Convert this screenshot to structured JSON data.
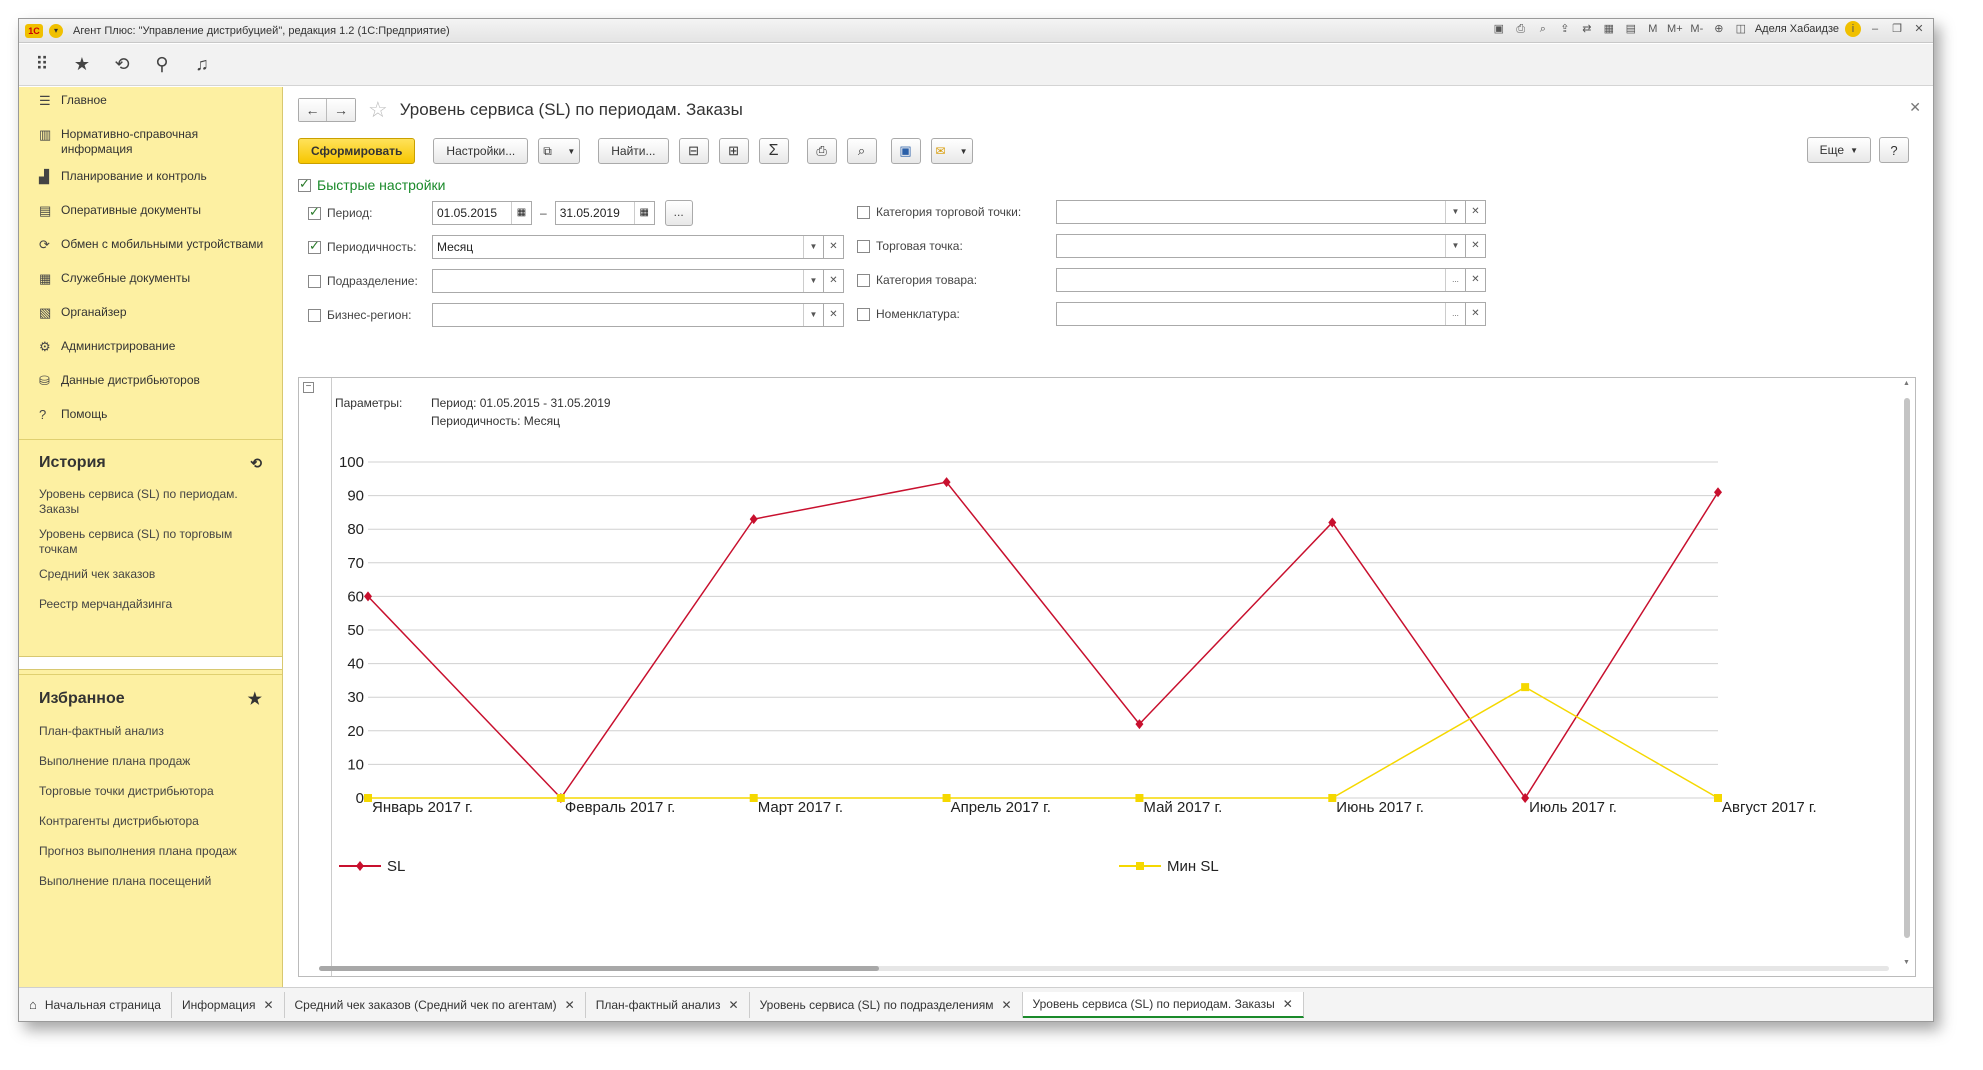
{
  "window": {
    "title": "Агент Плюс: \"Управление дистрибуцией\", редакция 1.2  (1С:Предприятие)",
    "user": "Аделя Хабаидзе"
  },
  "sidebar": {
    "items": [
      {
        "icon": "menu-icon",
        "glyph": "☰",
        "label": "Главное"
      },
      {
        "icon": "catalog-icon",
        "glyph": "▥",
        "label": "Нормативно-справочная информация"
      },
      {
        "icon": "chart-icon",
        "glyph": "▟",
        "label": "Планирование и контроль"
      },
      {
        "icon": "documents-icon",
        "glyph": "▤",
        "label": "Оперативные документы"
      },
      {
        "icon": "sync-icon",
        "glyph": "⟳",
        "label": "Обмен с мобильными устройствами"
      },
      {
        "icon": "service-docs-icon",
        "glyph": "▦",
        "label": "Служебные документы"
      },
      {
        "icon": "organizer-icon",
        "glyph": "▧",
        "label": "Органайзер"
      },
      {
        "icon": "gear-icon",
        "glyph": "⚙",
        "label": "Администрирование"
      },
      {
        "icon": "distributor-data-icon",
        "glyph": "⛁",
        "label": "Данные дистрибьюторов"
      },
      {
        "icon": "help-icon",
        "glyph": "?",
        "label": "Помощь"
      }
    ],
    "history": {
      "title": "История",
      "links": [
        "Уровень сервиса (SL) по периодам. Заказы",
        "Уровень сервиса (SL) по торговым точкам",
        "Средний чек заказов",
        "Реестр мерчандайзинга"
      ]
    },
    "favorites": {
      "title": "Избранное",
      "links": [
        "План-фактный анализ",
        "Выполнение плана продаж",
        "Торговые точки дистрибьютора",
        "Контрагенты дистрибьютора",
        "Прогноз выполнения плана продаж",
        "Выполнение плана посещений"
      ]
    }
  },
  "form": {
    "title": "Уровень сервиса (SL) по периодам. Заказы",
    "buttons": {
      "generate": "Сформировать",
      "settings": "Настройки...",
      "find": "Найти...",
      "more": "Еще",
      "help": "?"
    },
    "quick_settings_label": "Быстрые настройки",
    "filters": {
      "period_label": "Период:",
      "period_from": "01.05.2015",
      "period_to": "31.05.2019",
      "period_dash": "–",
      "periodicity_label": "Периодичность:",
      "periodicity_value": "Месяц",
      "department_label": "Подразделение:",
      "region_label": "Бизнес-регион:",
      "outlet_category_label": "Категория торговой точки:",
      "outlet_label": "Торговая точка:",
      "product_category_label": "Категория товара:",
      "nomenclature_label": "Номенклатура:"
    }
  },
  "report": {
    "params_label": "Параметры:",
    "params_period": "Период: 01.05.2015 - 31.05.2019",
    "params_periodicity": "Периодичность: Месяц"
  },
  "chart_data": {
    "type": "line",
    "categories": [
      "Январь 2017 г.",
      "Февраль 2017 г.",
      "Март 2017 г.",
      "Апрель 2017 г.",
      "Май 2017 г.",
      "Июнь 2017 г.",
      "Июль 2017 г.",
      "Август 2017 г."
    ],
    "series": [
      {
        "name": "SL",
        "color": "#c8102e",
        "values": [
          60,
          0,
          83,
          94,
          22,
          82,
          0,
          91
        ]
      },
      {
        "name": "Мин SL",
        "color": "#f5d800",
        "values": [
          0,
          0,
          0,
          0,
          0,
          0,
          33,
          0
        ]
      }
    ],
    "ylim": [
      0,
      100
    ],
    "yticks": [
      0,
      10,
      20,
      30,
      40,
      50,
      60,
      70,
      80,
      90,
      100
    ],
    "grid": true,
    "legend": "bottom"
  },
  "tabs": [
    {
      "label": "Начальная страница",
      "closable": false
    },
    {
      "label": "Информация",
      "closable": true
    },
    {
      "label": "Средний чек заказов (Средний чек по агентам)",
      "closable": true
    },
    {
      "label": "План-фактный анализ",
      "closable": true
    },
    {
      "label": "Уровень сервиса (SL) по подразделениям",
      "closable": true
    },
    {
      "label": "Уровень сервиса (SL) по периодам. Заказы",
      "closable": true,
      "active": true
    }
  ]
}
